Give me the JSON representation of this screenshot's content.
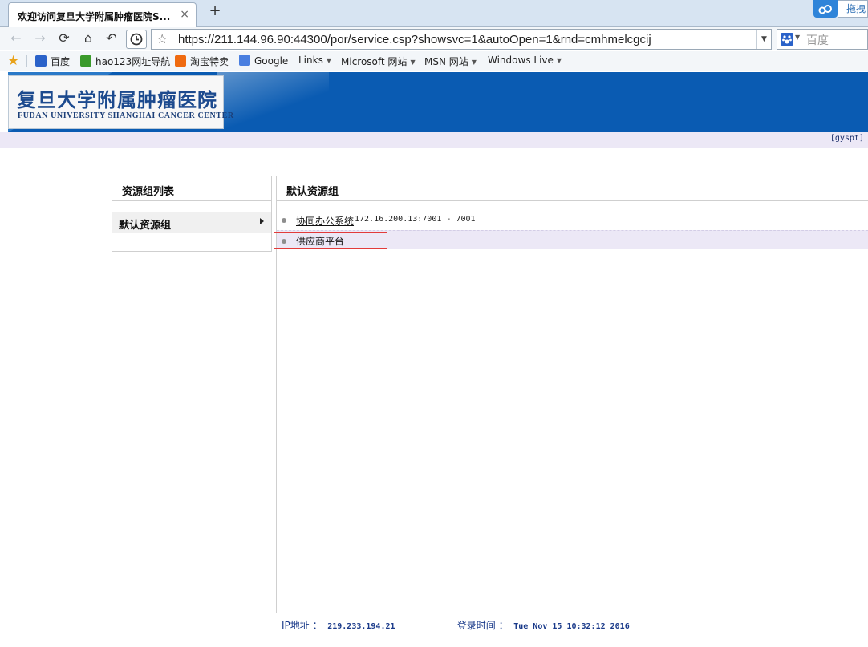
{
  "browser": {
    "tab_title": "欢迎访问复旦大学附属肿瘤医院S...",
    "tab_close": "×",
    "new_tab": "+",
    "drag_label": "拖拽",
    "address_url": "https://211.144.96.90:44300/por/service.csp?showsvc=1&autoOpen=1&rnd=cmhmelcgcij",
    "search_placeholder": "百度",
    "bookmarks": [
      {
        "label": "百度",
        "icon": "baidu-paw-icon",
        "color": "#2a62c9"
      },
      {
        "label": "hao123网址导航",
        "icon": "hao123-icon",
        "color": "#3a9a2b"
      },
      {
        "label": "淘宝特卖",
        "icon": "taobao-icon",
        "color": "#ef6a10"
      },
      {
        "label": "Google",
        "icon": "google-icon",
        "color": "#4a7fe0"
      },
      {
        "label": "Links",
        "icon": "",
        "color": ""
      },
      {
        "label": "Microsoft 网站",
        "icon": "",
        "color": ""
      },
      {
        "label": "MSN 网站",
        "icon": "",
        "color": ""
      },
      {
        "label": "Windows Live",
        "icon": "",
        "color": ""
      }
    ]
  },
  "page": {
    "hospital_name_cn": "复旦大学附属肿瘤医院",
    "hospital_name_en": "FUDAN UNIVERSITY SHANGHAI CANCER CENTER",
    "username": "[gyspt]",
    "left_panel": {
      "title": "资源组列表",
      "groups": [
        {
          "label": "默认资源组"
        }
      ]
    },
    "right_panel": {
      "title": "默认资源组",
      "resources": [
        {
          "name": "协同办公系统",
          "address": "172.16.200.13:7001 - 7001"
        },
        {
          "name": "供应商平台",
          "address": ""
        }
      ]
    },
    "footer": {
      "ip_label": "IP地址 ：",
      "ip_value": "219.233.194.21",
      "login_label": "登录时间 ：",
      "login_value": "Tue Nov 15 10:32:12 2016"
    }
  },
  "colors": {
    "banner_blue": "#0a5bb2",
    "userbar_lavender": "#ece8f6",
    "highlight_red": "#e23b3b"
  }
}
